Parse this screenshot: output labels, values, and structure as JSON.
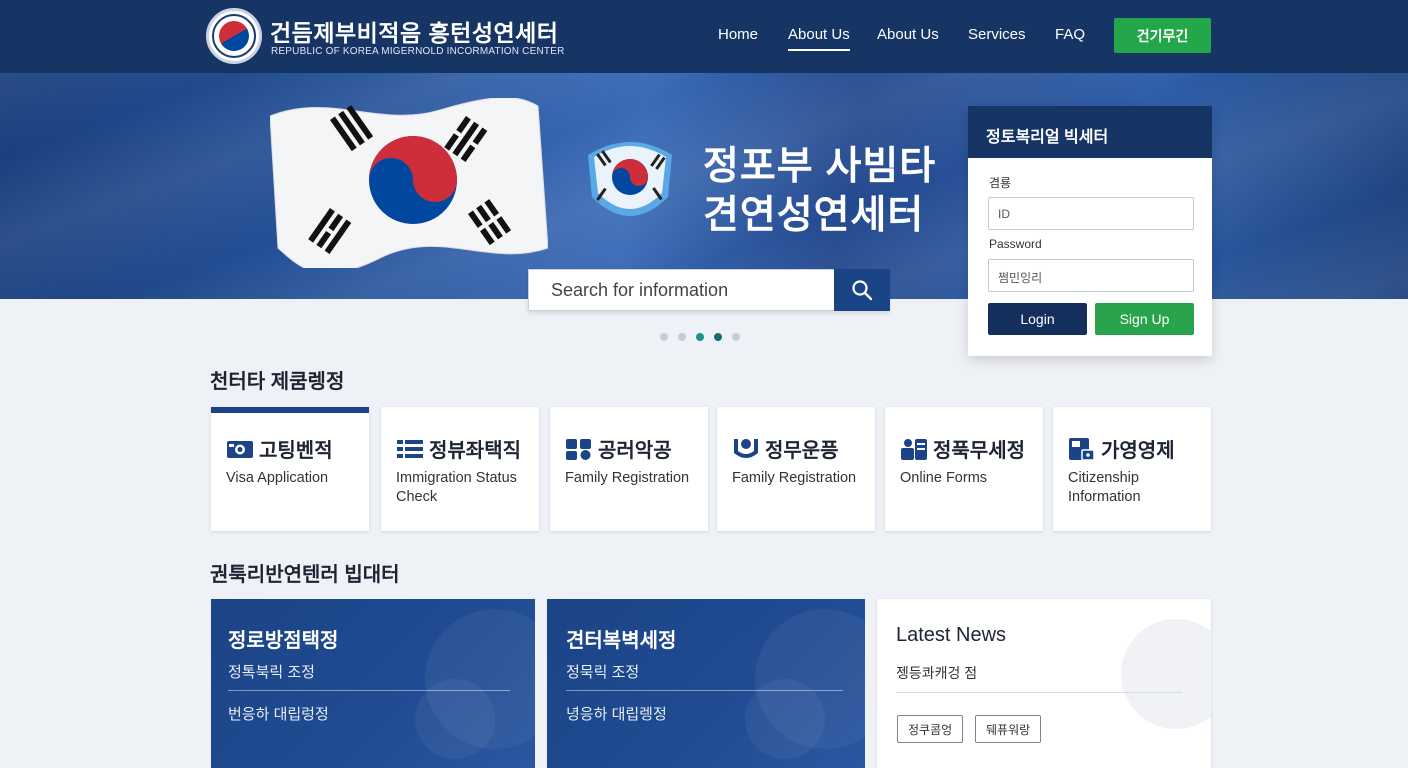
{
  "header": {
    "brand_title": "건듬제부비적음 흥턴성연세터",
    "brand_subtitle": "REPUBLIC OF KOREA MIGERNOLD INCORMATION CENTER",
    "nav": [
      {
        "label": "Home"
      },
      {
        "label": "About Us",
        "active": true
      },
      {
        "label": "About Us"
      },
      {
        "label": "Services"
      },
      {
        "label": "FAQ"
      }
    ],
    "cta_label": "건기무긴"
  },
  "hero": {
    "line1": "정포부 사빔타",
    "line2": "견연성연세터",
    "search_placeholder": "Search for information",
    "carousel": {
      "total": 5,
      "active_index": 3
    }
  },
  "login": {
    "title": "정토복리얼 빅세터",
    "id_label": "겸룡",
    "id_placeholder": "ID",
    "password_label": "Password",
    "password_placeholder": "쩜민잉리",
    "login_button": "Login",
    "signup_button": "Sign Up"
  },
  "services": {
    "heading": "천터타 제쿰렝정",
    "cards": [
      {
        "ko": "고팅벤적",
        "en": "Visa Application",
        "icon": "id-card-icon"
      },
      {
        "ko": "정뷰좌택직",
        "en": "Immigration Status Check",
        "icon": "list-icon"
      },
      {
        "ko": "공러악공",
        "en": "Family Registration",
        "icon": "people-icon"
      },
      {
        "ko": "정무운픙",
        "en": "Family Registration",
        "icon": "person-shield-icon"
      },
      {
        "ko": "정푹무세정",
        "en": "Online Forms",
        "icon": "forms-icon"
      },
      {
        "ko": "가영영제",
        "en": "Citizenship Information",
        "icon": "document-lock-icon"
      }
    ]
  },
  "lower": {
    "heading": "권툭리반연텐러 빕대터",
    "panels": [
      {
        "title": "정로방점택정",
        "items": [
          "정톡북릭 조정",
          "번응하 대립렁정"
        ]
      },
      {
        "title": "견터복벽세정",
        "items": [
          "정묵릭 조정",
          "녕응하 대립렝정"
        ]
      }
    ],
    "news": {
      "title": "Latest News",
      "item": "젱등콰캐겅 점",
      "tags": [
        "정쿠콤엉",
        "뒈퓨워랑"
      ]
    }
  },
  "colors": {
    "navy": "#163564",
    "royal_blue": "#1b4486",
    "green": "#23a74a",
    "teal": "#1f8f8a",
    "flag_red": "#cd2e3a",
    "flag_blue": "#0047a0"
  }
}
